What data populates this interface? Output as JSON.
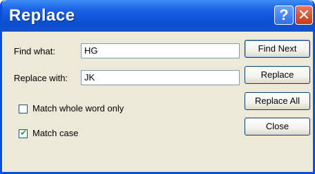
{
  "window": {
    "title": "Replace"
  },
  "titlebar": {
    "help_glyph": "?",
    "close_glyph": "✕"
  },
  "form": {
    "find_label": "Find what:",
    "find_value": "HG",
    "replace_label": "Replace with:",
    "replace_value": "JK"
  },
  "options": {
    "match_whole_word": {
      "label": "Match whole word only",
      "checked": false
    },
    "match_case": {
      "label": "Match case",
      "checked": true,
      "mark": "✔"
    }
  },
  "buttons": {
    "find_next": "Find Next",
    "replace": "Replace",
    "replace_all": "Replace All",
    "close": "Close"
  },
  "colors": {
    "title_bar": "#0b4fd4",
    "close_button": "#c73a14",
    "face": "#ece9d8"
  }
}
